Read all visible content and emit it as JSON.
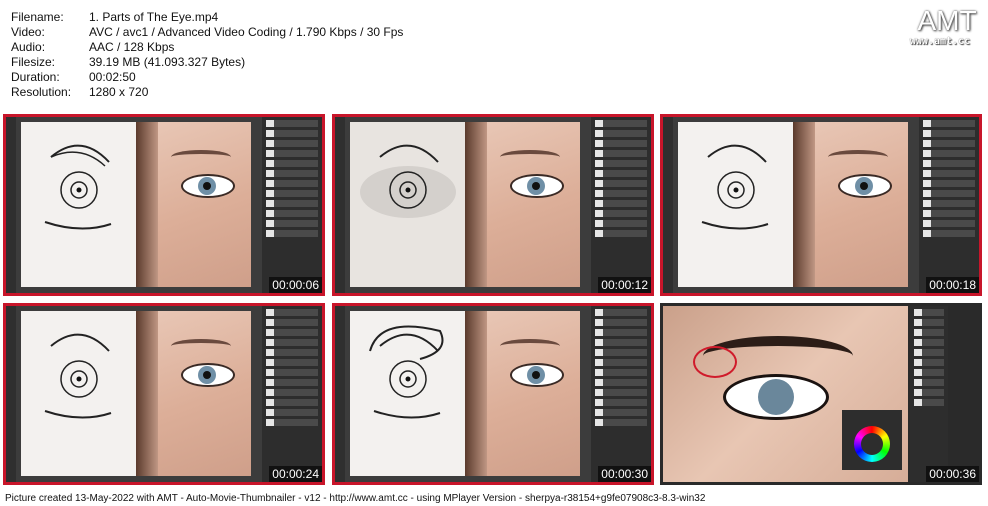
{
  "info": [
    {
      "label": "Filename:",
      "value": "1. Parts of The Eye.mp4"
    },
    {
      "label": "Video:",
      "value": "AVC / avc1 / Advanced Video Coding / 1.790 Kbps / 30 Fps"
    },
    {
      "label": "Audio:",
      "value": "AAC / 128 Kbps"
    },
    {
      "label": "Filesize:",
      "value": "39.19 MB (41.093.327 Bytes)"
    },
    {
      "label": "Duration:",
      "value": "00:02:50"
    },
    {
      "label": "Resolution:",
      "value": "1280 x 720"
    }
  ],
  "logo": {
    "text": "AMT",
    "url": "www.amt.cc"
  },
  "thumbnails": [
    {
      "timestamp": "00:00:06"
    },
    {
      "timestamp": "00:00:12"
    },
    {
      "timestamp": "00:00:18"
    },
    {
      "timestamp": "00:00:24"
    },
    {
      "timestamp": "00:00:30"
    },
    {
      "timestamp": "00:00:36"
    }
  ],
  "footer": "Picture created 13-May-2022 with AMT - Auto-Movie-Thumbnailer - v12 - http://www.amt.cc - using MPlayer Version - sherpya-r38154+g9fe07908c3-8.3-win32",
  "colors": {
    "frame": "#c8152a"
  }
}
